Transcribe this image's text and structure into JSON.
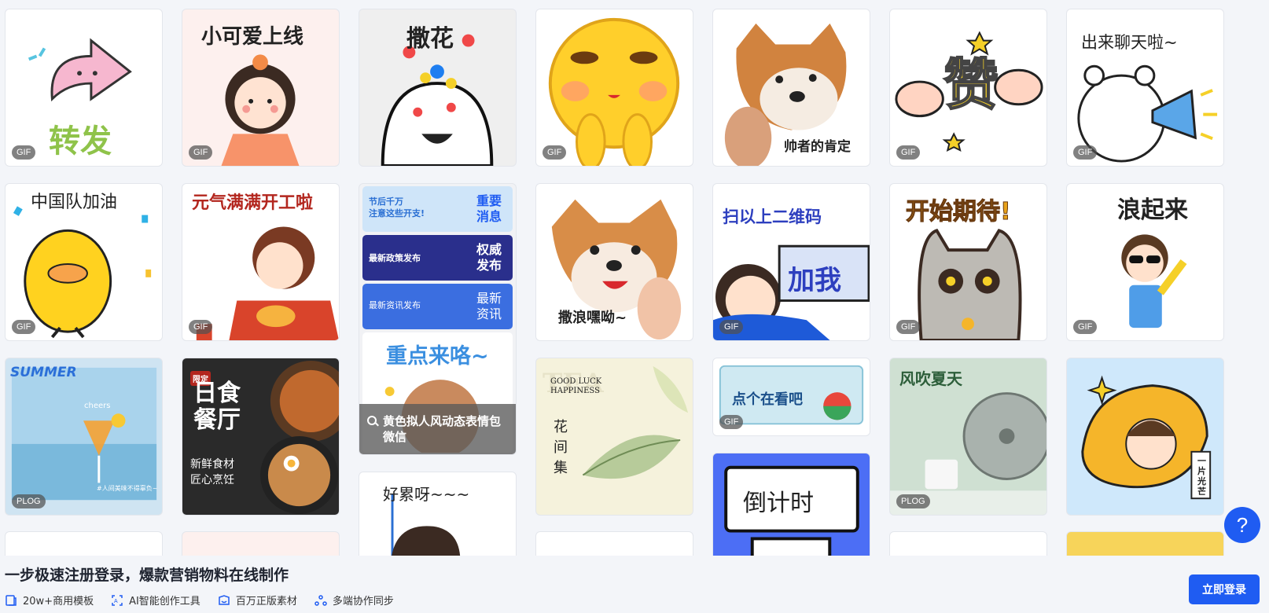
{
  "cards": {
    "c1": {
      "caption": "转发",
      "badge": "GIF"
    },
    "c2": {
      "caption": "小可爱上线",
      "badge": "GIF"
    },
    "c3": {
      "caption": "撒花"
    },
    "c4": {
      "badge": "GIF"
    },
    "c5": {
      "caption": "帅者的肯定"
    },
    "c6": {
      "caption": "赞",
      "badge": "GIF"
    },
    "c7": {
      "caption": "出来聊天啦~",
      "badge": "GIF"
    },
    "c8": {
      "caption": "中国队加油",
      "badge": "GIF"
    },
    "c9": {
      "caption": "元气满满开工啦",
      "badge": "GIF"
    },
    "c10": {
      "banners": [
        {
          "left": "节后千万\n注意这些开支!",
          "right": "重要\n消息"
        },
        {
          "left": "最新政策发布",
          "right": "权威\n发布"
        },
        {
          "left": "最新资讯发布",
          "right": "最新\n资讯"
        }
      ],
      "sticker_caption": "重点来咯~",
      "overlay_title": "黄色拟人风动态表情包微信"
    },
    "c11": {
      "caption": "撒浪嘿呦~"
    },
    "c12": {
      "caption": "扫以上二维码",
      "sign": "加我",
      "badge": "GIF"
    },
    "c13": {
      "caption": "开始期待!",
      "badge": "GIF"
    },
    "c14": {
      "caption": "浪起来",
      "badge": "GIF"
    },
    "c15": {
      "caption": "SUMMER",
      "sub": "cheers",
      "tag": "#人间美味不得辜负~",
      "badge": "PLOG"
    },
    "c16": {
      "title": "日食\n餐厅",
      "sub": "新鲜食材\n匠心烹饪",
      "tag": "限定"
    },
    "c17": {
      "caption": "好累呀~~~"
    },
    "c18": {
      "en": "GOOD LUCK\nHAPPINESS",
      "title": "花\n间\n集",
      "bg": "TEA"
    },
    "c19": {
      "caption": "点个在看吧",
      "badge": "GIF"
    },
    "c20": {
      "caption": "倒计时"
    },
    "c21": {
      "caption": "风吹夏天",
      "badge": "PLOG"
    },
    "c22": {
      "caption": "一片光芒"
    }
  },
  "bottom_bar": {
    "promo": "一步极速注册登录，爆款营销物料在线制作",
    "features": [
      {
        "icon": "template-icon",
        "label": "20w+商用模板"
      },
      {
        "icon": "ai-icon",
        "label": "AI智能创作工具"
      },
      {
        "icon": "material-icon",
        "label": "百万正版素材"
      },
      {
        "icon": "sync-icon",
        "label": "多端协作同步"
      }
    ],
    "login": "立即登录"
  },
  "help": "?",
  "colors": {
    "accent": "#1f5cf2",
    "bg": "#f3f5f9"
  }
}
